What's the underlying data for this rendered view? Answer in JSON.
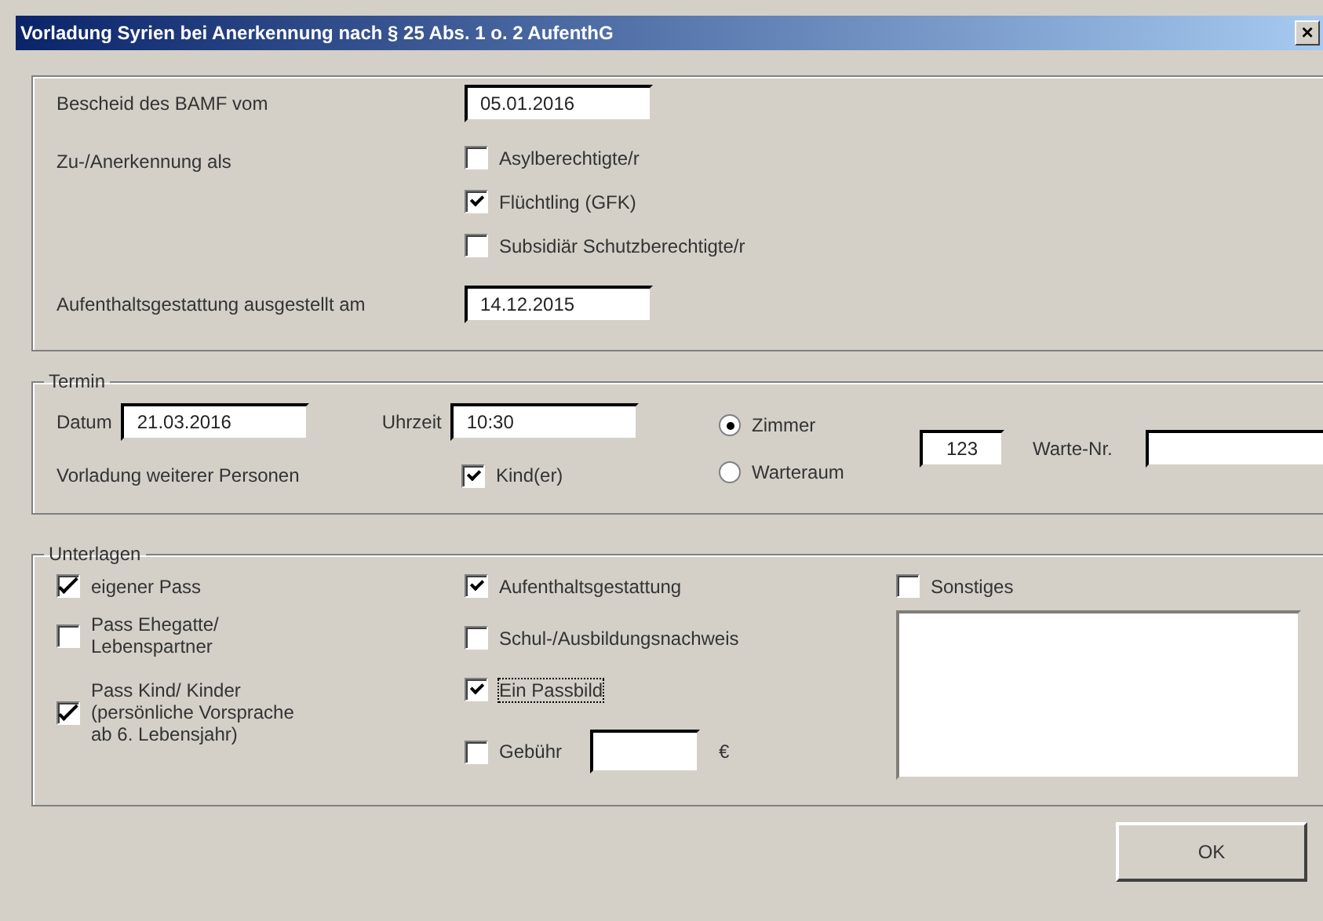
{
  "window": {
    "title": "Vorladung Syrien bei Anerkennung nach § 25 Abs. 1 o. 2 AufenthG",
    "close": "×"
  },
  "bescheid": {
    "label": "Bescheid des BAMF vom",
    "value": "05.01.2016"
  },
  "anerkennung": {
    "label": "Zu-/Anerkennung als",
    "options": [
      {
        "label": "Asylberechtigte/r",
        "checked": false
      },
      {
        "label": "Flüchtling (GFK)",
        "checked": true
      },
      {
        "label": "Subsidiär Schutzberechtigte/r",
        "checked": false
      }
    ]
  },
  "gestattung": {
    "label": "Aufenthaltsgestattung ausgestellt am",
    "value": "14.12.2015"
  },
  "termin": {
    "title": "Termin",
    "date": {
      "label": "Datum",
      "value": "21.03.2016"
    },
    "time": {
      "label": "Uhrzeit",
      "value": "10:30"
    },
    "rooms": [
      {
        "label": "Zimmer",
        "selected": true
      },
      {
        "label": "Warteraum",
        "selected": false
      }
    ],
    "room_number": "123",
    "wait_label": "Warte-Nr.",
    "others": {
      "label": "Vorladung weiterer Personen",
      "option": {
        "label": "Kind(er)",
        "checked": true
      }
    }
  },
  "unterlagen": {
    "title": "Unterlagen",
    "columns": [
      [
        {
          "kind": "checkbox",
          "label": "eigener Pass",
          "checked": true,
          "focused": false
        },
        {
          "kind": "checkbox",
          "label": "Pass Ehegatte/ Lebenspartner",
          "checked": false,
          "focused": false
        },
        {
          "kind": "checkbox",
          "label": "Pass Kind/ Kinder (persönliche Vorsprache ab 6. Lebensjahr)",
          "checked": true,
          "focused": false
        }
      ],
      [
        {
          "kind": "checkbox",
          "label": "Aufenthaltsgestattung",
          "checked": true,
          "focused": false
        },
        {
          "kind": "checkbox",
          "label": "Schul-/Ausbildungsnachweis",
          "checked": false,
          "focused": false
        },
        {
          "kind": "checkbox",
          "label": "Ein Passbild",
          "checked": true,
          "focused": true
        },
        {
          "kind": "fee",
          "label": "Gebühr",
          "checked": false,
          "focused": false,
          "suffix": "€"
        }
      ],
      [
        {
          "kind": "notes",
          "label": "Sonstiges",
          "checked": false,
          "focused": false
        }
      ]
    ]
  },
  "ok": "OK"
}
